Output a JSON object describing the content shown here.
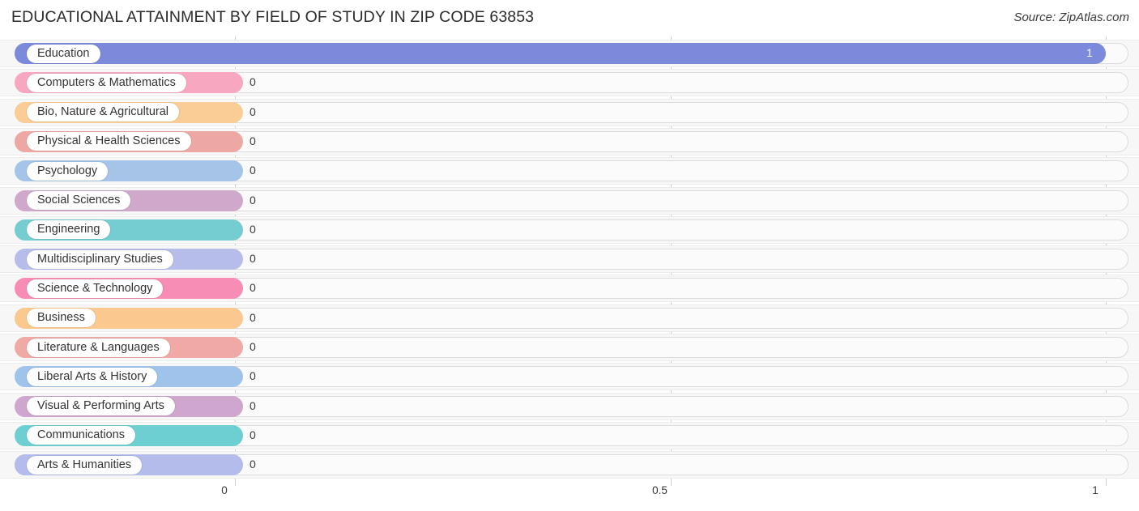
{
  "header": {
    "title": "EDUCATIONAL ATTAINMENT BY FIELD OF STUDY IN ZIP CODE 63853",
    "source": "Source: ZipAtlas.com"
  },
  "chart_data": {
    "type": "bar",
    "orientation": "horizontal",
    "title": "EDUCATIONAL ATTAINMENT BY FIELD OF STUDY IN ZIP CODE 63853",
    "subtitle": "",
    "xlabel": "",
    "ylabel": "",
    "xlim": [
      0,
      1
    ],
    "grid": true,
    "legend": false,
    "xticks": [
      "0",
      "0.5",
      "1"
    ],
    "xtick_values": [
      0,
      0.5,
      1
    ],
    "categories": [
      "Education",
      "Computers & Mathematics",
      "Bio, Nature & Agricultural",
      "Physical & Health Sciences",
      "Psychology",
      "Social Sciences",
      "Engineering",
      "Multidisciplinary Studies",
      "Science & Technology",
      "Business",
      "Literature & Languages",
      "Liberal Arts & History",
      "Visual & Performing Arts",
      "Communications",
      "Arts & Humanities"
    ],
    "values": [
      1,
      0,
      0,
      0,
      0,
      0,
      0,
      0,
      0,
      0,
      0,
      0,
      0,
      0,
      0
    ],
    "value_labels": [
      "1",
      "0",
      "0",
      "0",
      "0",
      "0",
      "0",
      "0",
      "0",
      "0",
      "0",
      "0",
      "0",
      "0",
      "0"
    ],
    "colors": [
      "#7b8ada",
      "#f7a8c0",
      "#fbcd96",
      "#eda8a4",
      "#a6c4e8",
      "#cfa8cb",
      "#76cdd1",
      "#b6bdea",
      "#f78cb4",
      "#fbc98f",
      "#f0a9a4",
      "#9fc3ea",
      "#cfa6cd",
      "#6ecfd2",
      "#b3bcea"
    ]
  }
}
